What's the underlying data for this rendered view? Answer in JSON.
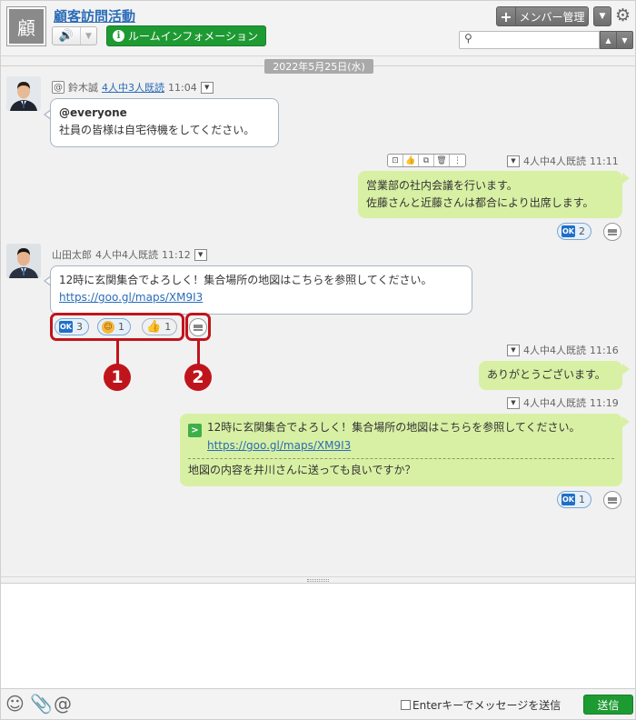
{
  "header": {
    "room_avatar_char": "顧",
    "room_title": "顧客訪問活動",
    "room_info_label": "ルームインフォメーション",
    "member_label": "メンバー管理",
    "plus_label": "+",
    "search_placeholder": ""
  },
  "chat": {
    "date": "2022年5月25日(水)",
    "messages": [
      {
        "sender": "鈴木誠",
        "read_status": "4人中3人既読",
        "time": "11:04",
        "mention": "@everyone",
        "text": "社員の皆様は自宅待機をしてください。"
      },
      {
        "read_status": "4人中4人既読",
        "time": "11:11",
        "line1": "営業部の社内会議を行います。",
        "line2": "佐藤さんと近藤さんは都合により出席します。",
        "reaction_ok_count": "2"
      },
      {
        "sender": "山田太郎",
        "read_status": "4人中4人既読",
        "time": "11:12",
        "line1": "12時に玄関集合でよろしく！集合場所の地図はこちらを参照してください。",
        "link": "https://goo.gl/maps/XM9I3",
        "reactions": {
          "ok": "3",
          "smile": "1",
          "thumbs": "1"
        }
      },
      {
        "read_status": "4人中4人既読",
        "time": "11:16",
        "text": "ありがとうございます。"
      },
      {
        "read_status": "4人中4人既読",
        "time": "11:19",
        "quote_line1": "12時に玄関集合でよろしく！集合場所の地図はこちらを参照してください。",
        "quote_link": "https://goo.gl/maps/XM9I3",
        "text": "地図の内容を井川さんに送っても良いですか？",
        "reaction_ok_count": "1"
      }
    ]
  },
  "annotations": {
    "n1": "1",
    "n2": "2"
  },
  "footer": {
    "enter_label": "Enterキーでメッセージを送信",
    "send_label": "送信"
  },
  "colors": {
    "accent_green": "#1e9a32",
    "link_blue": "#2a6cb8",
    "bubble_green": "#d8f0a4",
    "annotation_red": "#c0141c"
  }
}
